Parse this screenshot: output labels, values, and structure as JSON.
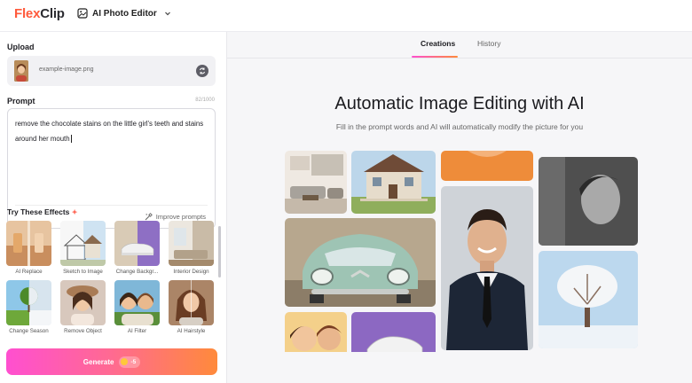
{
  "header": {
    "logo_part1": "Flex",
    "logo_part2": "Clip",
    "tool_label": "AI Photo Editor",
    "tool_icon": "photo-edit-icon",
    "dropdown_icon": "chevron-down-icon"
  },
  "upload": {
    "title": "Upload",
    "file_name": "example-image.png",
    "swap_icon": "swap-icon"
  },
  "prompt": {
    "title": "Prompt",
    "char_count": "82/1000",
    "text": "remove the chocolate stains on the little girl's teeth and stains around her mouth",
    "improve_label": "Improve prompts",
    "improve_icon": "magic-wand-icon"
  },
  "effects": {
    "title": "Try These Effects",
    "items": [
      {
        "label": "AI Replace"
      },
      {
        "label": "Sketch to Image"
      },
      {
        "label": "Change Backgr..."
      },
      {
        "label": "Interior Design"
      },
      {
        "label": "Change Season"
      },
      {
        "label": "Remove Object"
      },
      {
        "label": "AI Filter"
      },
      {
        "label": "AI Hairstyle"
      }
    ]
  },
  "generate": {
    "label": "Generate",
    "cost": "-5",
    "coin_icon": "coin-icon"
  },
  "tabs": [
    {
      "label": "Creations",
      "active": true
    },
    {
      "label": "History",
      "active": false
    }
  ],
  "hero": {
    "title": "Automatic Image Editing with AI",
    "subtitle": "Fill in the prompt words and AI will automatically modify the picture for you"
  },
  "colors": {
    "accent_start": "#ff4fd0",
    "accent_end": "#ff8a3b",
    "logo": "#ff5a3c"
  }
}
